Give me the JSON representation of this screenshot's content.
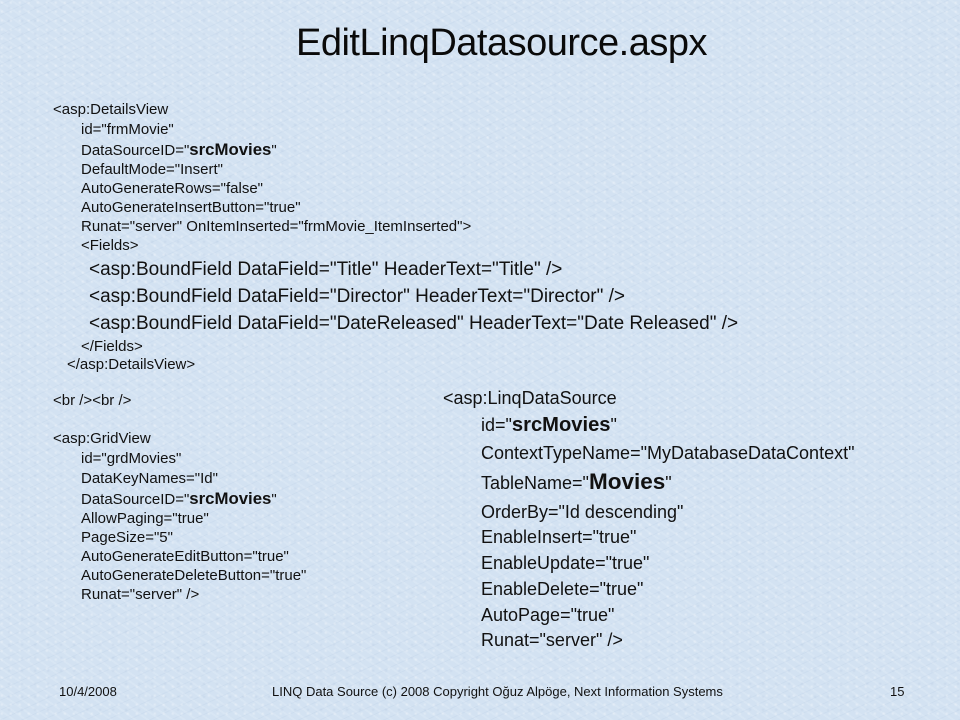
{
  "slide": {
    "title": "EditLinqDatasource.aspx",
    "details_view": {
      "open_tag": "<asp:DetailsView",
      "attributes": [
        {
          "text": "id=\"frmMovie\""
        },
        {
          "prefix": "DataSourceID=\"",
          "highlight": "srcMovies",
          "suffix": "\""
        },
        {
          "text": "DefaultMode=\"Insert\""
        },
        {
          "text": "AutoGenerateRows=\"false\""
        },
        {
          "text": "AutoGenerateInsertButton=\"true\""
        },
        {
          "text": "Runat=\"server\" OnItemInserted=\"frmMovie_ItemInserted\">"
        }
      ],
      "fields_open": "<Fields>",
      "bound_fields": [
        "<asp:BoundField DataField=\"Title\" HeaderText=\"Title\" />",
        "<asp:BoundField DataField=\"Director\" HeaderText=\"Director\" />",
        "<asp:BoundField DataField=\"DateReleased\" HeaderText=\"Date Released\" />"
      ],
      "fields_close": "</Fields>",
      "close_tag": "</asp:DetailsView>"
    },
    "br_tags": "<br /><br />",
    "grid_view": {
      "open_tag": "<asp:GridView",
      "attributes": [
        {
          "text": "id=\"grdMovies\""
        },
        {
          "text": "DataKeyNames=\"Id\""
        },
        {
          "prefix": "DataSourceID=\"",
          "highlight": "srcMovies",
          "suffix": "\""
        },
        {
          "text": "AllowPaging=\"true\""
        },
        {
          "text": "PageSize=\"5\""
        },
        {
          "text": "AutoGenerateEditButton=\"true\""
        },
        {
          "text": "AutoGenerateDeleteButton=\"true\""
        },
        {
          "text": "Runat=\"server\" />"
        }
      ]
    },
    "linq_data_source": {
      "open_tag": "<asp:LinqDataSource",
      "attributes": [
        {
          "prefix": "id=\"",
          "highlight": "srcMovies",
          "suffix": "\""
        },
        {
          "text": "ContextTypeName=\"MyDatabaseDataContext\""
        },
        {
          "prefix": "TableName=\"",
          "highlight": "Movies",
          "suffix": "\""
        },
        {
          "text": "OrderBy=\"Id descending\""
        },
        {
          "text": "EnableInsert=\"true\""
        },
        {
          "text": "EnableUpdate=\"true\""
        },
        {
          "text": "EnableDelete=\"true\""
        },
        {
          "text": "AutoPage=\"true\""
        },
        {
          "text": "Runat=\"server\" />"
        }
      ]
    }
  },
  "footer": {
    "date": "10/4/2008",
    "center": "LINQ Data Source (c) 2008 Copyright Oğuz Alpöge, Next Information Systems",
    "page_number": "15"
  }
}
